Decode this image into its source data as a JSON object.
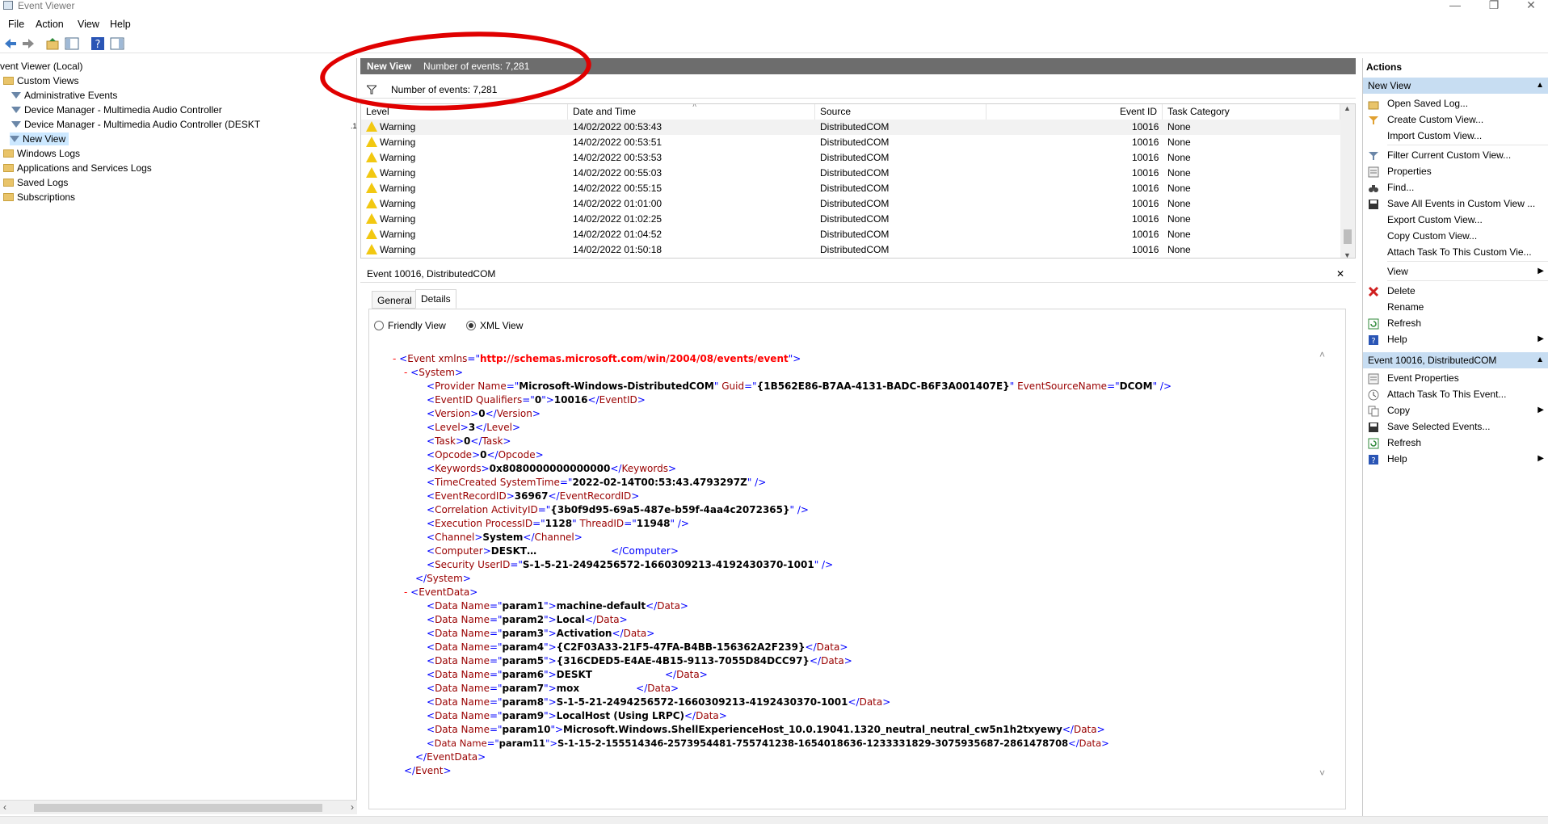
{
  "window": {
    "title": "Event Viewer",
    "minimize": "—",
    "restore": "❐",
    "close": "✕"
  },
  "menu": [
    "File",
    "Action",
    "View",
    "Help"
  ],
  "tree": {
    "items": [
      {
        "label": "vent Viewer (Local)"
      },
      {
        "label": "Custom Views"
      },
      {
        "label": "Administrative Events"
      },
      {
        "label": "Device Manager - Multimedia Audio Controller"
      },
      {
        "label": "Device Manager - Multimedia Audio Controller (DESKT"
      },
      {
        "label": "New View"
      },
      {
        "label": "Windows Logs"
      },
      {
        "label": "Applications and Services Logs"
      },
      {
        "label": "Saved Logs"
      },
      {
        "label": "Subscriptions"
      }
    ],
    "ellipsis": ".1"
  },
  "view_header": {
    "title": "New View",
    "count": "Number of events: 7,281"
  },
  "filter_bar": {
    "text": "Number of events: 7,281"
  },
  "grid": {
    "columns": [
      "Level",
      "Date and Time",
      "Source",
      "Event ID",
      "Task Category"
    ],
    "rows": [
      {
        "level": "Warning",
        "date": "14/02/2022 00:53:43",
        "source": "DistributedCOM",
        "id": "10016",
        "cat": "None"
      },
      {
        "level": "Warning",
        "date": "14/02/2022 00:53:51",
        "source": "DistributedCOM",
        "id": "10016",
        "cat": "None"
      },
      {
        "level": "Warning",
        "date": "14/02/2022 00:53:53",
        "source": "DistributedCOM",
        "id": "10016",
        "cat": "None"
      },
      {
        "level": "Warning",
        "date": "14/02/2022 00:55:03",
        "source": "DistributedCOM",
        "id": "10016",
        "cat": "None"
      },
      {
        "level": "Warning",
        "date": "14/02/2022 00:55:15",
        "source": "DistributedCOM",
        "id": "10016",
        "cat": "None"
      },
      {
        "level": "Warning",
        "date": "14/02/2022 01:01:00",
        "source": "DistributedCOM",
        "id": "10016",
        "cat": "None"
      },
      {
        "level": "Warning",
        "date": "14/02/2022 01:02:25",
        "source": "DistributedCOM",
        "id": "10016",
        "cat": "None"
      },
      {
        "level": "Warning",
        "date": "14/02/2022 01:04:52",
        "source": "DistributedCOM",
        "id": "10016",
        "cat": "None"
      },
      {
        "level": "Warning",
        "date": "14/02/2022 01:50:18",
        "source": "DistributedCOM",
        "id": "10016",
        "cat": "None"
      }
    ]
  },
  "detail": {
    "title": "Event 10016, DistributedCOM",
    "close": "✕",
    "tabs": [
      "General",
      "Details"
    ],
    "radios": [
      "Friendly View",
      "XML View"
    ],
    "selected_radio": "XML View"
  },
  "xml": {
    "event_open_tag": "Event",
    "event_xmlns_attr": "xmlns",
    "event_xmlns": "http://schemas.microsoft.com/win/2004/08/events/event",
    "system_tag": "System",
    "provider_tag": "Provider",
    "provider_name_attr": "Name",
    "provider_name": "Microsoft-Windows-DistributedCOM",
    "provider_guid_attr": "Guid",
    "provider_guid": "{1B562E86-B7AA-4131-BADC-B6F3A001407E}",
    "provider_esn_attr": "EventSourceName",
    "provider_esn": "DCOM",
    "eventid_tag": "EventID",
    "eventid_qual_attr": "Qualifiers",
    "eventid_qual": "0",
    "eventid": "10016",
    "version_tag": "Version",
    "version": "0",
    "level_tag": "Level",
    "level": "3",
    "task_tag": "Task",
    "task": "0",
    "opcode_tag": "Opcode",
    "opcode": "0",
    "keywords_tag": "Keywords",
    "keywords": "0x8080000000000000",
    "timecreated_tag": "TimeCreated",
    "systemtime_attr": "SystemTime",
    "timecreated": "2022-02-14T00:53:43.4793297Z",
    "recordid_tag": "EventRecordID",
    "recordid": "36967",
    "correlation_tag": "Correlation",
    "activityid_attr": "ActivityID",
    "activityid": "{3b0f9d95-69a5-487e-b59f-4aa4c2072365}",
    "execution_tag": "Execution",
    "processid_attr": "ProcessID",
    "processid": "1128",
    "threadid_attr": "ThreadID",
    "threadid": "11948",
    "channel_tag": "Channel",
    "channel": "System",
    "computer_tag": "Computer",
    "computer": "DESKT…",
    "computer_tail": "</Computer>",
    "security_tag": "Security",
    "userid_attr": "UserID",
    "userid": "S-1-5-21-2494256572-1660309213-4192430370-1001",
    "eventdata_tag": "EventData",
    "data_tag": "Data",
    "data_name_attr": "Name",
    "data": [
      {
        "name": "param1",
        "value": "machine-default"
      },
      {
        "name": "param2",
        "value": "Local"
      },
      {
        "name": "param3",
        "value": "Activation"
      },
      {
        "name": "param4",
        "value": "{C2F03A33-21F5-47FA-B4BB-156362A2F239}"
      },
      {
        "name": "param5",
        "value": "{316CDED5-E4AE-4B15-9113-7055D84DCC97}"
      },
      {
        "name": "param6",
        "value": "DESKT"
      },
      {
        "name": "param7",
        "value": "mox"
      },
      {
        "name": "param8",
        "value": "S-1-5-21-2494256572-1660309213-4192430370-1001"
      },
      {
        "name": "param9",
        "value": "LocalHost (Using LRPC)"
      },
      {
        "name": "param10",
        "value": "Microsoft.Windows.ShellExperienceHost_10.0.19041.1320_neutral_neutral_cw5n1h2txyewy"
      },
      {
        "name": "param11",
        "value": "S-1-15-2-155514346-2573954481-755741238-1654018636-1233331829-3075935687-2861478708"
      }
    ]
  },
  "actions": {
    "title": "Actions",
    "section1": "New View",
    "items1": [
      {
        "label": "Open Saved Log...",
        "icon": "open-log-icon"
      },
      {
        "label": "Create Custom View...",
        "icon": "filter-icon"
      },
      {
        "label": "Import Custom View...",
        "icon": ""
      },
      {
        "label": "Filter Current Custom View...",
        "icon": "filter-icon"
      },
      {
        "label": "Properties",
        "icon": "properties-icon"
      },
      {
        "label": "Find...",
        "icon": "binoculars-icon"
      },
      {
        "label": "Save All Events in Custom View ...",
        "icon": "save-icon"
      },
      {
        "label": "Export Custom View...",
        "icon": ""
      },
      {
        "label": "Copy Custom View...",
        "icon": ""
      },
      {
        "label": "Attach Task To This Custom Vie...",
        "icon": ""
      },
      {
        "label": "View",
        "icon": "",
        "submenu": true
      },
      {
        "label": "Delete",
        "icon": "delete-icon"
      },
      {
        "label": "Rename",
        "icon": ""
      },
      {
        "label": "Refresh",
        "icon": "refresh-icon"
      },
      {
        "label": "Help",
        "icon": "help-icon",
        "submenu": true
      }
    ],
    "section2": "Event 10016, DistributedCOM",
    "items2": [
      {
        "label": "Event Properties",
        "icon": "properties-icon"
      },
      {
        "label": "Attach Task To This Event...",
        "icon": "task-icon"
      },
      {
        "label": "Copy",
        "icon": "copy-icon",
        "submenu": true
      },
      {
        "label": "Save Selected Events...",
        "icon": "save-icon"
      },
      {
        "label": "Refresh",
        "icon": "refresh-icon"
      },
      {
        "label": "Help",
        "icon": "help-icon",
        "submenu": true
      }
    ]
  },
  "colors": {
    "annotation": "#e00000",
    "header_dark": "#6d6d6d",
    "section_blue": "#c7ddf2",
    "selection": "#cce8ff",
    "warning": "#f2c811"
  }
}
